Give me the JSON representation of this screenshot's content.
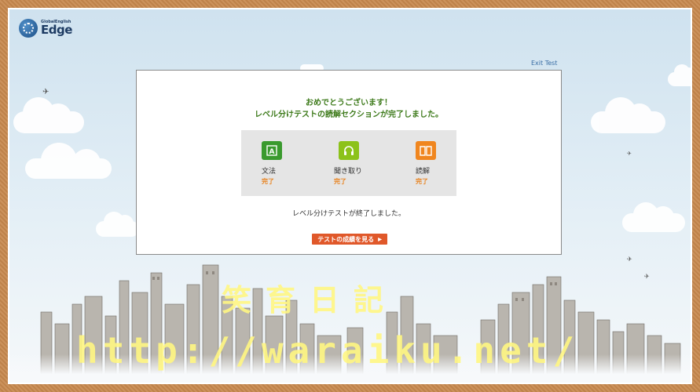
{
  "logo": {
    "small": "GlobalEnglish",
    "big": "Edge"
  },
  "header": {
    "exit_label": "Exit Test"
  },
  "dialog": {
    "congrats_line1": "おめでとうございます！",
    "congrats_line2": "レベル分けテストの読解セクションが完了しました。",
    "sections": [
      {
        "label": "文法",
        "status": "完了",
        "icon": "grammar-book-icon",
        "color": "#3a9a2e"
      },
      {
        "label": "聞き取り",
        "status": "完了",
        "icon": "headphones-icon",
        "color": "#8cc21a"
      },
      {
        "label": "読解",
        "status": "完了",
        "icon": "open-book-icon",
        "color": "#f0861f"
      }
    ],
    "finished_text": "レベル分けテストが終了しました。",
    "result_button": "テストの成績を見る"
  },
  "watermark": {
    "line1": "笑育日記",
    "line2": "http://waraiku.net/"
  }
}
